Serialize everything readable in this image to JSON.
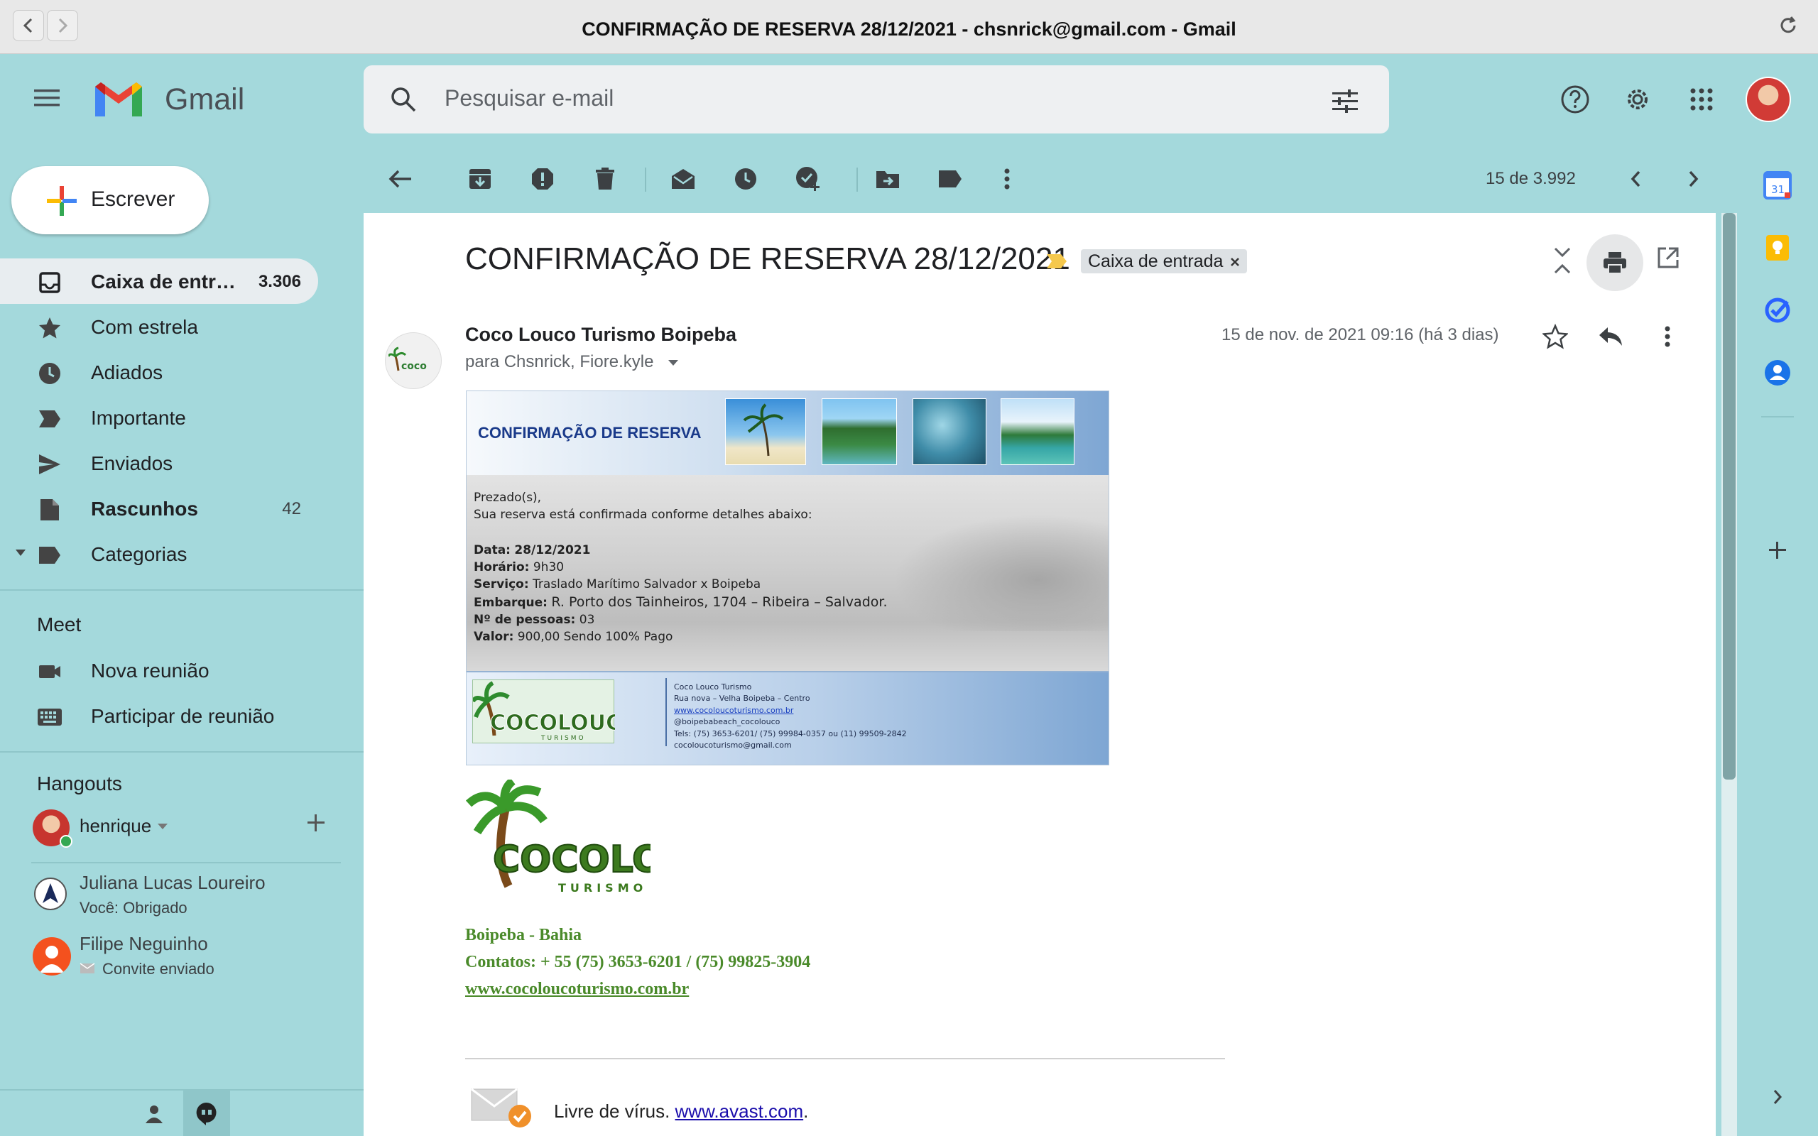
{
  "window": {
    "title": "CONFIRMAÇÃO DE RESERVA 28/12/2021 - chsnrick@gmail.com - Gmail"
  },
  "header": {
    "app_name": "Gmail",
    "search_placeholder": "Pesquisar e-mail"
  },
  "sidebar": {
    "compose_label": "Escrever",
    "items": [
      {
        "label": "Caixa de entr…",
        "count": "3.306",
        "icon": "inbox-icon"
      },
      {
        "label": "Com estrela",
        "count": "",
        "icon": "star-icon"
      },
      {
        "label": "Adiados",
        "count": "",
        "icon": "clock-icon"
      },
      {
        "label": "Importante",
        "count": "",
        "icon": "important-icon"
      },
      {
        "label": "Enviados",
        "count": "",
        "icon": "send-icon"
      },
      {
        "label": "Rascunhos",
        "count": "42",
        "icon": "draft-icon"
      },
      {
        "label": "Categorias",
        "count": "",
        "icon": "label-icon"
      }
    ],
    "meet": {
      "title": "Meet",
      "new_meeting": "Nova reunião",
      "join_meeting": "Participar de reunião"
    },
    "hangouts": {
      "title": "Hangouts",
      "user": "henrique",
      "contacts": [
        {
          "name": "Juliana Lucas Loureiro",
          "status": "Você: Obrigado"
        },
        {
          "name": "Filipe Neguinho",
          "status": "Convite enviado"
        }
      ]
    }
  },
  "toolbar": {
    "pager": "15 de 3.992"
  },
  "email": {
    "subject": "CONFIRMAÇÃO DE RESERVA 28/12/2021",
    "label_chip": "Caixa de entrada",
    "sender": "Coco Louco Turismo Boipeba",
    "recipients": "para Chsnrick, Fiore.kyle",
    "date": "15 de nov. de 2021 09:16 (há 3 dias)",
    "card": {
      "header_title": "CONFIRMAÇÃO DE RESERVA",
      "greeting": "Prezado(s),",
      "intro": "Sua reserva está confirmada conforme detalhes abaixo:",
      "data_label": "Data:",
      "data_value": "28/12/2021",
      "horario_label": "Horário:",
      "horario_value": "9h30",
      "servico_label": "Serviço:",
      "servico_value": "Traslado Marítimo  Salvador x Boipeba",
      "embarque_label": "Embarque:",
      "embarque_value": "R. Porto dos Tainheiros, 1704 – Ribeira – Salvador.",
      "pessoas_label": "Nº de pessoas:",
      "pessoas_value": "03",
      "valor_label": "Valor:",
      "valor_value": "900,00 Sendo 100% Pago",
      "logo_text": "COCOLOUCO",
      "logo_sub": "TURISMO",
      "info": [
        "Coco Louco Turismo",
        "Rua nova – Velha Boipeba – Centro",
        "www.cocoloucoturismo.com.br",
        "@boipebabeach_cocolouco",
        "Tels: (75) 3653-6201/ (75) 99984-0357 ou (11) 99509-2842",
        "cocoloucoturismo@gmail.com"
      ]
    },
    "logo_text": "COCOLOUCO",
    "logo_sub": "TURISMO",
    "signature": {
      "location": "Boipeba - Bahia",
      "contacts": "Contatos: + 55 (75) 3653-6201 / (75) 99825-3904",
      "website": "www.cocoloucoturismo.com.br"
    },
    "avast_text": "Livre de vírus.",
    "avast_link": "www.avast.com",
    "avast_end": "."
  },
  "right_panel": {
    "calendar_day": "31"
  },
  "colors": {
    "background": "#a4d9dc",
    "signature_green": "#4a8a2a",
    "card_title_blue": "#1a3a8a"
  }
}
